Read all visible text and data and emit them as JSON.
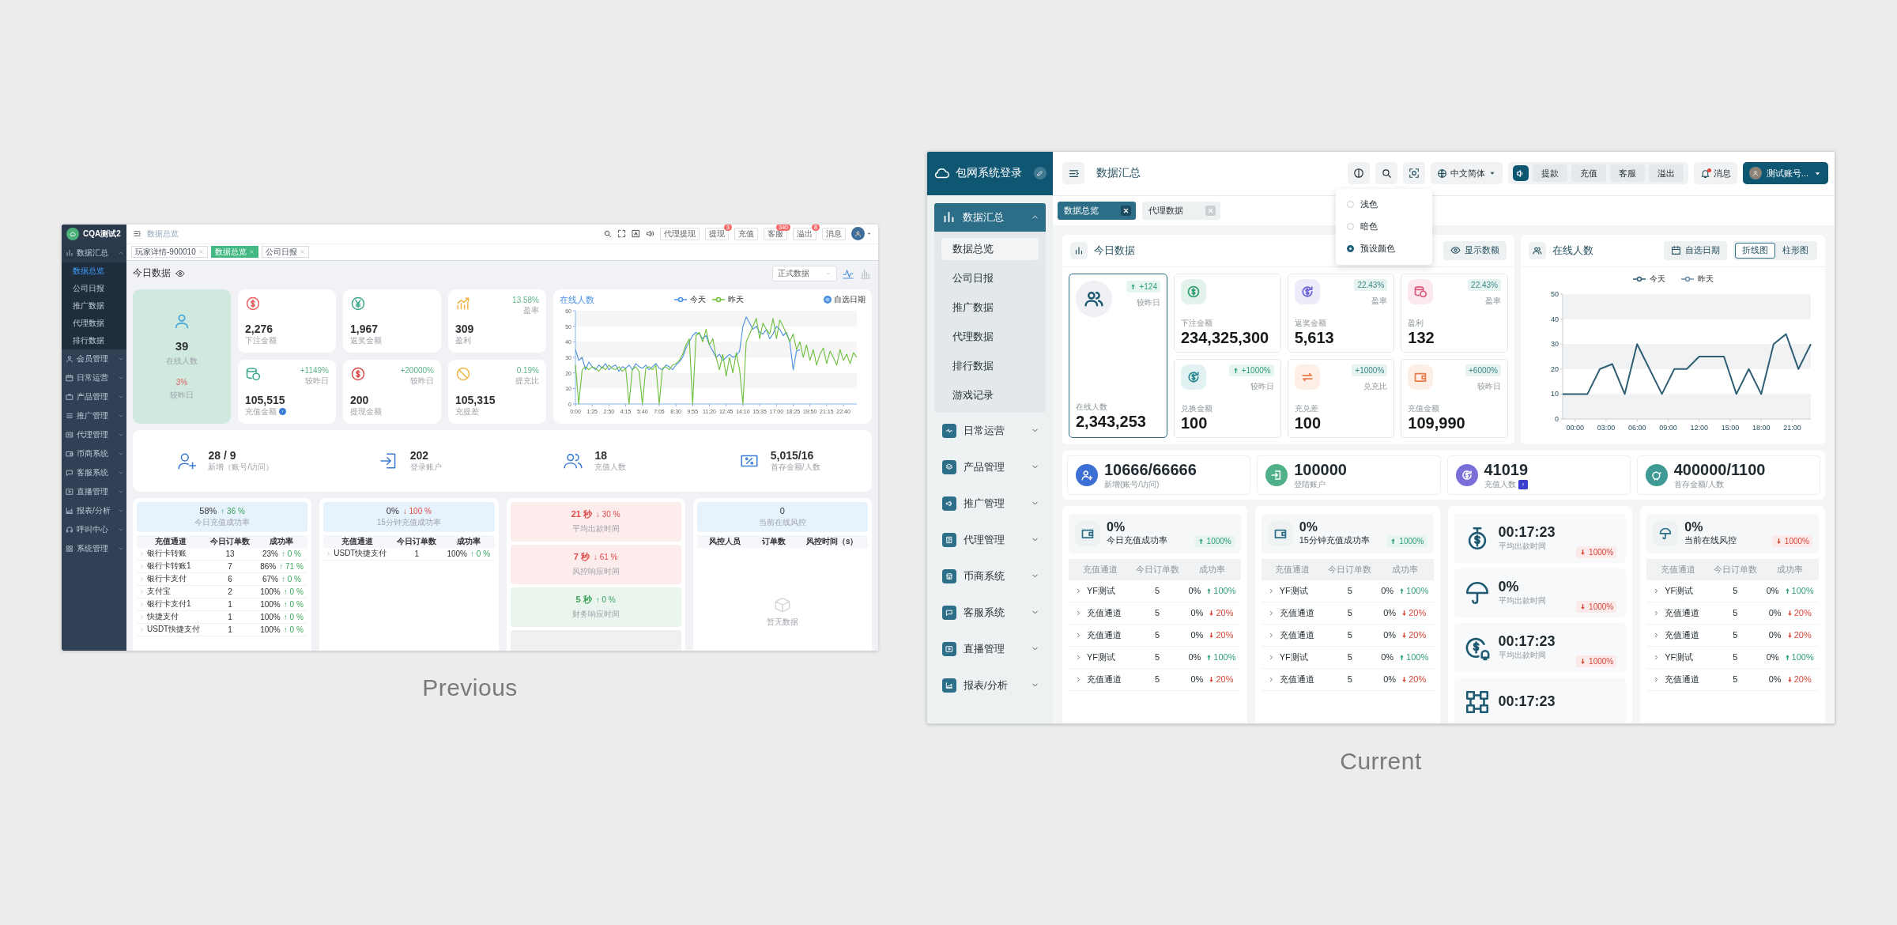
{
  "previous": {
    "caption": "Previous",
    "brand": "CQA测试2",
    "nav": [
      {
        "label": "数据汇总",
        "expanded": true,
        "children": [
          {
            "label": "数据总览",
            "selected": true
          },
          {
            "label": "公司日报",
            "selected": false
          },
          {
            "label": "推广数据",
            "selected": false
          },
          {
            "label": "代理数据",
            "selected": false
          },
          {
            "label": "排行数据",
            "selected": false
          }
        ]
      },
      {
        "label": "会员管理",
        "expanded": false
      },
      {
        "label": "日常运营",
        "expanded": false
      },
      {
        "label": "产品管理",
        "expanded": false
      },
      {
        "label": "推广管理",
        "expanded": false
      },
      {
        "label": "代理管理",
        "expanded": false
      },
      {
        "label": "币商系统",
        "expanded": false
      },
      {
        "label": "客服系统",
        "expanded": false
      },
      {
        "label": "直播管理",
        "expanded": false
      },
      {
        "label": "报表/分析",
        "expanded": false
      },
      {
        "label": "呼叫中心",
        "expanded": false
      },
      {
        "label": "系统管理",
        "expanded": false
      }
    ],
    "breadcrumb": "数据总览",
    "toolbar_buttons": [
      {
        "label": "代理提现"
      },
      {
        "label": "提现",
        "badge": "3"
      },
      {
        "label": "充值"
      },
      {
        "label": "客服",
        "badge": "340"
      },
      {
        "label": "溢出",
        "badge": "8"
      },
      {
        "label": "消息"
      }
    ],
    "tabs": [
      {
        "label": "玩家详情-900010",
        "selected": false
      },
      {
        "label": "数据总览",
        "selected": true
      },
      {
        "label": "公司日报",
        "selected": false
      }
    ],
    "section_title": "今日数据",
    "data_source": "正式数据",
    "view_toggle": [
      {
        "kind": "line",
        "selected": true
      },
      {
        "kind": "bar",
        "selected": false
      }
    ],
    "online": {
      "value": "39",
      "label": "在线人数",
      "change": "3%",
      "change_label": "较昨日"
    },
    "metrics": [
      {
        "value": "2,276",
        "label": "下注金额"
      },
      {
        "value": "1,967",
        "label": "返奖金额"
      },
      {
        "value": "309",
        "label": "盈利",
        "change": "13.58%",
        "change_label": "盈率"
      },
      {
        "value": "105,515",
        "label": "充值金额",
        "help": true,
        "change": "+1149%",
        "change_label": "较昨日"
      },
      {
        "value": "200",
        "label": "提现金额",
        "change": "+20000%",
        "change_label": "较昨日"
      },
      {
        "value": "105,315",
        "label": "充提差",
        "change": "0.19%",
        "change_label": "提充比"
      }
    ],
    "online_chart": {
      "title": "在线人数",
      "date_button": "自选日期",
      "chart_data": {
        "type": "line",
        "xlim": [
          0,
          1428
        ],
        "ylim": [
          0,
          60
        ],
        "yticks": [
          0,
          10,
          20,
          30,
          40,
          50,
          60
        ],
        "xticks": [
          {
            "value": 0,
            "label": "0:00"
          },
          {
            "value": 85,
            "label": "1:25"
          },
          {
            "value": 170,
            "label": "2:50"
          },
          {
            "value": 255,
            "label": "4:15"
          },
          {
            "value": 340,
            "label": "5:40"
          },
          {
            "value": 425,
            "label": "7:05"
          },
          {
            "value": 510,
            "label": "8:30"
          },
          {
            "value": 595,
            "label": "9:55"
          },
          {
            "value": 680,
            "label": "11:20"
          },
          {
            "value": 765,
            "label": "12:45"
          },
          {
            "value": 850,
            "label": "14:10"
          },
          {
            "value": 935,
            "label": "15:35"
          },
          {
            "value": 1020,
            "label": "17:00"
          },
          {
            "value": 1105,
            "label": "18:25"
          },
          {
            "value": 1190,
            "label": "19:50"
          },
          {
            "value": 1275,
            "label": "21:15"
          },
          {
            "value": 1360,
            "label": "22:40"
          }
        ],
        "x": [
          0,
          17,
          34,
          51,
          68,
          85,
          102,
          119,
          136,
          153,
          170,
          187,
          204,
          221,
          238,
          255,
          272,
          289,
          306,
          323,
          340,
          357,
          374,
          391,
          408,
          425,
          442,
          459,
          476,
          493,
          510,
          527,
          544,
          561,
          578,
          595,
          612,
          629,
          646,
          663,
          680,
          697,
          714,
          731,
          748,
          765,
          782,
          799,
          816,
          833,
          850,
          867,
          884,
          901,
          918,
          935,
          952,
          969,
          986,
          1003,
          1020,
          1037,
          1054,
          1071,
          1088,
          1105,
          1122,
          1139,
          1156,
          1173,
          1190,
          1207,
          1224,
          1241,
          1258,
          1275,
          1292,
          1309,
          1326,
          1343,
          1360,
          1377,
          1394,
          1411,
          1428
        ],
        "series": [
          {
            "name": "今天",
            "color": "#4a8fe0",
            "values": [
              35,
              28,
              30,
              22,
              27,
              24,
              22,
              25,
              23,
              26,
              22,
              24,
              25,
              21,
              24,
              23,
              25,
              22,
              26,
              24,
              23,
              25,
              22,
              24,
              26,
              23,
              22,
              25,
              24,
              22,
              25,
              27,
              30,
              36,
              40,
              44,
              46,
              45,
              42,
              44,
              38,
              34,
              30,
              32,
              28,
              30,
              32,
              30,
              31,
              34,
              50,
              56,
              52,
              48,
              50,
              46,
              45,
              48,
              42,
              45,
              50,
              48,
              44,
              46,
              40,
              22,
              34,
              35,
              null,
              null,
              null,
              null,
              null,
              null,
              null,
              null,
              null,
              null,
              null,
              null,
              null,
              null,
              null,
              null,
              null
            ]
          },
          {
            "name": "昨天",
            "color": "#6bbf3a",
            "values": [
              25,
              0,
              22,
              24,
              22,
              24,
              23,
              21,
              24,
              22,
              25,
              23,
              22,
              24,
              21,
              23,
              0,
              22,
              24,
              21,
              0,
              23,
              24,
              22,
              25,
              0,
              23,
              24,
              22,
              25,
              26,
              28,
              32,
              38,
              42,
              0,
              44,
              46,
              40,
              48,
              38,
              42,
              30,
              22,
              32,
              18,
              30,
              20,
              33,
              22,
              0,
              40,
              45,
              50,
              55,
              42,
              52,
              48,
              45,
              55,
              42,
              54,
              50,
              45,
              40,
              45,
              35,
              40,
              30,
              38,
              28,
              35,
              25,
              32,
              36,
              26,
              34,
              30,
              25,
              35,
              28,
              32,
              26,
              33,
              30
            ]
          }
        ]
      }
    },
    "stats": [
      {
        "value": "28 / 9",
        "label": "新增（账号/访问）"
      },
      {
        "value": "202",
        "label": "登录账户"
      },
      {
        "value": "18",
        "label": "充值人数"
      },
      {
        "value": "5,015/16",
        "label": "首存金额/人数"
      }
    ],
    "recharge_panels": [
      {
        "value": "58%",
        "change": "↑ 36 %",
        "rising": true,
        "label": "今日充值成功率",
        "columns": [
          "充值通道",
          "今日订单数",
          "成功率"
        ],
        "rows": [
          {
            "channel": "银行卡转账",
            "orders": "13",
            "rate": "23%",
            "change": "↑ 0 %",
            "rising": true
          },
          {
            "channel": "银行卡转账1",
            "orders": "7",
            "rate": "86%",
            "change": "↑ 71 %",
            "rising": true
          },
          {
            "channel": "银行卡支付",
            "orders": "6",
            "rate": "67%",
            "change": "↑ 0 %",
            "rising": true
          },
          {
            "channel": "支付宝",
            "orders": "2",
            "rate": "100%",
            "change": "↑ 0 %",
            "rising": true
          },
          {
            "channel": "银行卡支付1",
            "orders": "1",
            "rate": "100%",
            "change": "↑ 0 %",
            "rising": true
          },
          {
            "channel": "快捷支付",
            "orders": "1",
            "rate": "100%",
            "change": "↑ 0 %",
            "rising": true
          },
          {
            "channel": "USDT快捷支付",
            "orders": "1",
            "rate": "100%",
            "change": "↑ 0 %",
            "rising": true
          }
        ]
      },
      {
        "value": "0%",
        "change": "↓ 100 %",
        "rising": false,
        "label": "15分钟充值成功率",
        "columns": [
          "充值通道",
          "今日订单数",
          "成功率"
        ],
        "rows": [
          {
            "channel": "USDT快捷支付",
            "orders": "1",
            "rate": "100%",
            "change": "↑ 0 %",
            "rising": true
          }
        ]
      }
    ],
    "timing": [
      {
        "value": "21 秒",
        "change": "↓ 30 %",
        "rising": false,
        "label": "平均出款时间"
      },
      {
        "value": "7 秒",
        "change": "↓ 61 %",
        "rising": false,
        "label": "风控响应时间"
      },
      {
        "value": "5 秒",
        "change": "↑ 0 %",
        "rising": true,
        "label": "财务响应时间"
      }
    ],
    "risk": {
      "value": "0",
      "label": "当前在线风控",
      "columns": [
        "风控人员",
        "订单数",
        "风控时间（s）"
      ],
      "empty": "暂无数据"
    }
  },
  "current": {
    "caption": "Current",
    "brand": "包网系统登录",
    "nav": [
      {
        "label": "数据汇总",
        "expanded": true,
        "children": [
          {
            "label": "数据总览",
            "selected": true
          },
          {
            "label": "公司日报",
            "selected": false
          },
          {
            "label": "推广数据",
            "selected": false
          },
          {
            "label": "代理数据",
            "selected": false
          },
          {
            "label": "排行数据",
            "selected": false
          },
          {
            "label": "游戏记录",
            "selected": false
          }
        ]
      },
      {
        "label": "日常运营",
        "expanded": false
      },
      {
        "label": "产品管理",
        "expanded": false
      },
      {
        "label": "推广管理",
        "expanded": false
      },
      {
        "label": "代理管理",
        "expanded": false
      },
      {
        "label": "币商系统",
        "expanded": false
      },
      {
        "label": "客服系统",
        "expanded": false
      },
      {
        "label": "直播管理",
        "expanded": false
      },
      {
        "label": "报表/分析",
        "expanded": false
      }
    ],
    "page_title": "数据汇总",
    "language": "中文简体",
    "quick_buttons": [
      "提款",
      "充值",
      "客服",
      "溢出"
    ],
    "messages": {
      "label": "消息",
      "unread": true
    },
    "account": "测试账号...",
    "tabs": [
      {
        "label": "数据总览",
        "selected": true
      },
      {
        "label": "代理数据",
        "selected": false
      }
    ],
    "theme_menu": [
      {
        "label": "浅色",
        "selected": false
      },
      {
        "label": "暗色",
        "selected": false
      },
      {
        "label": "预设颜色",
        "selected": true
      }
    ],
    "today": {
      "title": "今日数据",
      "toggle_label": "显示数额",
      "online": {
        "label": "在线人数",
        "value": "2,343,253",
        "change": "+124",
        "change_label": "较昨日",
        "arrow": true
      },
      "metrics": [
        {
          "label": "下注金额",
          "value": "234,325,300"
        },
        {
          "label": "返奖金额",
          "value": "5,613",
          "change": "22.43%",
          "change_label": "盈率",
          "arrow": false
        },
        {
          "label": "盈利",
          "value": "132",
          "change": "22.43%",
          "change_label": "盈率",
          "arrow": false
        },
        {
          "label": "兑换金额",
          "value": "100",
          "change": "+1000%",
          "change_label": "较昨日",
          "arrow": true
        },
        {
          "label": "充兑差",
          "value": "100",
          "change": "+1000%",
          "change_label": "兑充比",
          "arrow": false
        },
        {
          "label": "充值金额",
          "value": "109,990",
          "change": "+6000%",
          "change_label": "较昨日",
          "arrow": false
        }
      ]
    },
    "online_chart": {
      "title": "在线人数",
      "date_button": "自选日期",
      "views": [
        {
          "label": "折线图",
          "selected": true
        },
        {
          "label": "柱形图",
          "selected": false
        }
      ],
      "chart_data": {
        "type": "line",
        "xlim": [
          -1.2,
          22.8
        ],
        "ylim": [
          0,
          50
        ],
        "yticks": [
          0,
          10,
          20,
          30,
          40,
          50
        ],
        "xticks": [
          {
            "value": 0,
            "label": "00:00"
          },
          {
            "value": 3,
            "label": "03:00"
          },
          {
            "value": 6,
            "label": "06:00"
          },
          {
            "value": 9,
            "label": "09:00"
          },
          {
            "value": 12,
            "label": "12:00"
          },
          {
            "value": 15,
            "label": "15:00"
          },
          {
            "value": 18,
            "label": "18:00"
          },
          {
            "value": 21,
            "label": "21:00"
          }
        ],
        "x": [
          -1.2,
          0,
          1.2,
          2.4,
          3.6,
          4.8,
          6,
          7.2,
          8.4,
          9.6,
          10.8,
          12,
          13.2,
          14.4,
          15.6,
          16.8,
          18,
          19.2,
          20.4,
          21.6,
          22.8
        ],
        "series": [
          {
            "name": "今天",
            "color": "#2f5f74",
            "values": [
              10,
              10,
              10,
              20,
              22,
              10,
              30,
              20,
              10,
              20,
              20,
              25,
              25,
              25,
              10,
              20,
              10,
              30,
              34,
              20,
              30
            ]
          },
          {
            "name": "昨天",
            "color": "#6f8fa8",
            "values": [
              null,
              null,
              null,
              null,
              null,
              null,
              null,
              null,
              null,
              null,
              null,
              null,
              null,
              null,
              null,
              null,
              null,
              null,
              null,
              null,
              null
            ]
          }
        ]
      }
    },
    "stats": [
      {
        "value": "10666/66666",
        "label": "新增(账号/访问)"
      },
      {
        "value": "100000",
        "label": "登陆账户"
      },
      {
        "value": "41019",
        "label": "充值人数",
        "help": true
      },
      {
        "value": "400000/1100",
        "label": "首存金额/人数"
      }
    ],
    "recharge_panels": [
      {
        "value": "0%",
        "label": "今日充值成功率",
        "change": "1000%",
        "rising": true,
        "columns": [
          "充值通道",
          "今日订单数",
          "成功率"
        ],
        "rows": [
          {
            "channel": "YF测试",
            "orders": "5",
            "rate": "0%",
            "change": "100%",
            "rising": true
          },
          {
            "channel": "充值通道",
            "orders": "5",
            "rate": "0%",
            "change": "20%",
            "rising": false
          },
          {
            "channel": "充值通道",
            "orders": "5",
            "rate": "0%",
            "change": "20%",
            "rising": false
          },
          {
            "channel": "YF测试",
            "orders": "5",
            "rate": "0%",
            "change": "100%",
            "rising": true
          },
          {
            "channel": "充值通道",
            "orders": "5",
            "rate": "0%",
            "change": "20%",
            "rising": false
          }
        ]
      },
      {
        "value": "0%",
        "label": "15分钟充值成功率",
        "change": "1000%",
        "rising": true,
        "columns": [
          "充值通道",
          "今日订单数",
          "成功率"
        ],
        "rows": [
          {
            "channel": "YF测试",
            "orders": "5",
            "rate": "0%",
            "change": "100%",
            "rising": true
          },
          {
            "channel": "充值通道",
            "orders": "5",
            "rate": "0%",
            "change": "20%",
            "rising": false
          },
          {
            "channel": "充值通道",
            "orders": "5",
            "rate": "0%",
            "change": "20%",
            "rising": false
          },
          {
            "channel": "YF测试",
            "orders": "5",
            "rate": "0%",
            "change": "100%",
            "rising": true
          },
          {
            "channel": "充值通道",
            "orders": "5",
            "rate": "0%",
            "change": "20%",
            "rising": false
          }
        ]
      }
    ],
    "timing": [
      {
        "value": "00:17:23",
        "label": "平均出款时间",
        "change": "1000%",
        "rising": false
      },
      {
        "value": "0%",
        "label": "平均出款时间",
        "change": "1000%",
        "rising": false
      },
      {
        "value": "00:17:23",
        "label": "平均出款时间",
        "change": "1000%",
        "rising": false
      },
      {
        "value": "00:17:23"
      }
    ],
    "risk": {
      "value": "0%",
      "label": "当前在线风控",
      "change": "1000%",
      "rising": false,
      "columns": [
        "充值通道",
        "今日订单数",
        "成功率"
      ],
      "rows": [
        {
          "channel": "YF测试",
          "orders": "5",
          "rate": "0%",
          "change": "100%",
          "rising": true
        },
        {
          "channel": "充值通道",
          "orders": "5",
          "rate": "0%",
          "change": "20%",
          "rising": false
        },
        {
          "channel": "充值通道",
          "orders": "5",
          "rate": "0%",
          "change": "20%",
          "rising": false
        },
        {
          "channel": "YF测试",
          "orders": "5",
          "rate": "0%",
          "change": "100%",
          "rising": true
        },
        {
          "channel": "充值通道",
          "orders": "5",
          "rate": "0%",
          "change": "20%",
          "rising": false
        }
      ]
    }
  }
}
